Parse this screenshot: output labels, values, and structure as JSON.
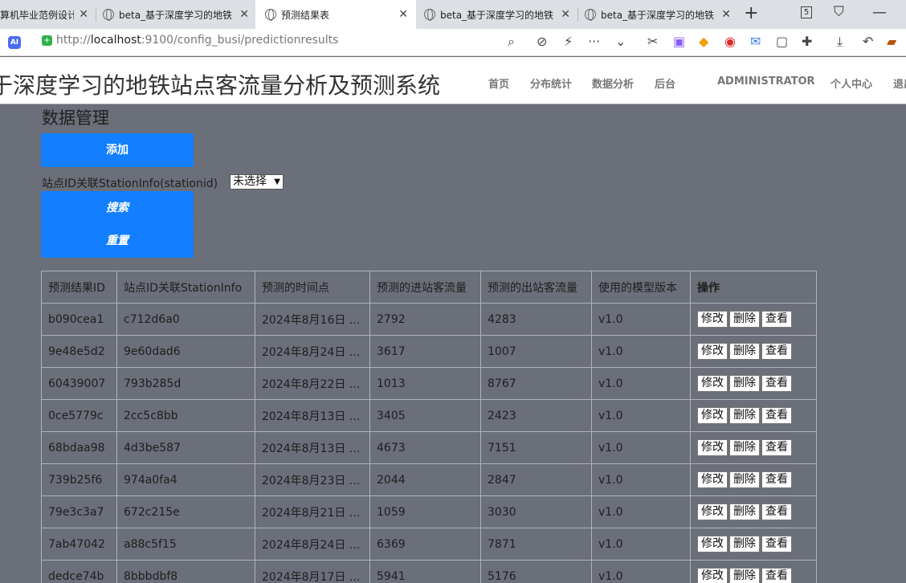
{
  "browser": {
    "tabs": [
      {
        "title": "算机毕业范例设计",
        "active": false
      },
      {
        "title": "beta_基于深度学习的地铁",
        "active": false
      },
      {
        "title": "预测结果表",
        "active": true
      },
      {
        "title": "beta_基于深度学习的地铁",
        "active": false
      },
      {
        "title": "beta_基于深度学习的地铁",
        "active": false
      }
    ],
    "tab_count": "5",
    "url_prefix": "http://",
    "url_host": "localhost",
    "url_path": ":9100/config_busi/predictionresults"
  },
  "site": {
    "title": "于深度学习的地铁站点客流量分析及预测系统",
    "nav": [
      "首页",
      "分布统计",
      "数据分析",
      "后台",
      "ADMINISTRATOR",
      "个人中心",
      "退出"
    ]
  },
  "page": {
    "section_title": "数据管理",
    "add_label": "添加",
    "filter_label": "站点ID关联StationInfo(stationid)",
    "filter_value": "未选择",
    "search_label": "搜索",
    "reset_label": "重置"
  },
  "table": {
    "headers": [
      "预测结果ID",
      "站点ID关联StationInfo",
      "预测的时间点",
      "预测的进站客流量",
      "预测的出站客流量",
      "使用的模型版本",
      "操作"
    ],
    "action_labels": [
      "修改",
      "删除",
      "查看"
    ],
    "rows": [
      [
        "b090cea1",
        "c712d6a0",
        "2024年8月16日 ...",
        "2792",
        "4283",
        "v1.0"
      ],
      [
        "9e48e5d2",
        "9e60dad6",
        "2024年8月24日 ...",
        "3617",
        "1007",
        "v1.0"
      ],
      [
        "60439007",
        "793b285d",
        "2024年8月22日 ...",
        "1013",
        "8767",
        "v1.0"
      ],
      [
        "0ce5779c",
        "2cc5c8bb",
        "2024年8月13日 ...",
        "3405",
        "2423",
        "v1.0"
      ],
      [
        "68bdaa98",
        "4d3be587",
        "2024年8月13日 ...",
        "4673",
        "7151",
        "v1.0"
      ],
      [
        "739b25f6",
        "974a0fa4",
        "2024年8月23日 ...",
        "2044",
        "2847",
        "v1.0"
      ],
      [
        "79e3c3a7",
        "672c215e",
        "2024年8月21日 ...",
        "1059",
        "3030",
        "v1.0"
      ],
      [
        "7ab47042",
        "a88c5f15",
        "2024年8月24日 ...",
        "6369",
        "7871",
        "v1.0"
      ],
      [
        "dedce74b",
        "8bbbdbf8",
        "2024年8月17日 ...",
        "5941",
        "5176",
        "v1.0"
      ]
    ]
  }
}
